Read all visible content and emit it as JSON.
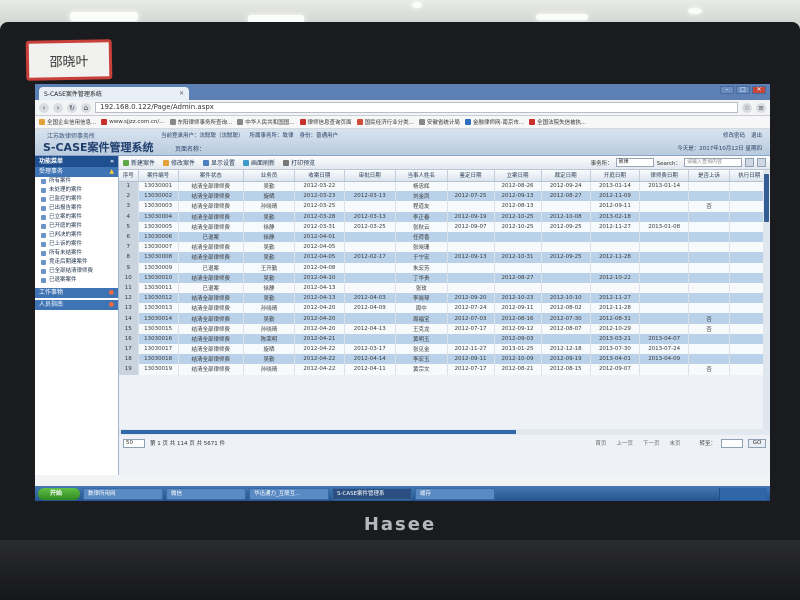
{
  "sticky_note": "邵晓叶",
  "laptop_brand": "Hasee",
  "browser": {
    "tab_title": "S-CASE案件管理系统",
    "url": "192.168.0.122/Page/Admin.aspx",
    "bookmarks": [
      "全国企业信用信息...",
      "www.sjjzz.com.cn/...",
      "东阳律师事务所查询...",
      "中华人民共和国国...",
      "律师信息查询页面",
      "国民经济行业分类...",
      "安徽省统计局",
      "金融律师网-南京市...",
      "全国法院失信被执..."
    ]
  },
  "app": {
    "company": "江苏致律师事务所",
    "title": "S-CASE案件管理系统",
    "user_info": [
      "当前登录用户：沈聪聪（沈聪聪）",
      "所属事务所：致律",
      "身份：普通用户"
    ],
    "page_name_label": "页面名称：",
    "top_links": [
      "修改密码",
      "退出"
    ],
    "date": "今天是：2017年10月12日 星期四"
  },
  "sidebar": {
    "header": "功能菜单",
    "section1": "受理事务",
    "items": [
      "所有案件",
      "未处理的案件",
      "已监控的案件",
      "已出报告案件",
      "已立案的案件",
      "已开庭的案件",
      "已判决的案件",
      "已上诉的案件",
      "所有未结案件",
      "竞走后期建案件",
      "已全部结清律师费",
      "已退案案件"
    ],
    "section2": "工作事物",
    "section3": "人员指南"
  },
  "toolbar": {
    "buttons": [
      "新建案件",
      "修改案件",
      "显示设置",
      "画面刷新",
      "打印预览"
    ],
    "filter_label": "事务所：",
    "filter_value": "致律",
    "search_label": "Search：",
    "search_placeholder": "请输入查询内容"
  },
  "table": {
    "columns": [
      "序号",
      "案件编号",
      "案件状态",
      "业务员",
      "收案日期",
      "审批日期",
      "当事人姓名",
      "鉴定日期",
      "立案日期",
      "裁定日期",
      "开庭日期",
      "律师费日期",
      "是否上诉",
      "执行日期"
    ],
    "rows": [
      [
        "1",
        "13030001",
        "结清全部律师费",
        "吴勤",
        "2012-03-22",
        "",
        "杨忠辉",
        "",
        "2012-08-26",
        "2012-09-24",
        "2013-01-14",
        "2013-01-14",
        "",
        ""
      ],
      [
        "2",
        "13030002",
        "结清全部律师费",
        "旋晒",
        "2012-03-23",
        "2012-03-13",
        "刘金凤",
        "2012-07-25",
        "2012-09-13",
        "2012-08-27",
        "2012-11-09",
        "",
        "",
        ""
      ],
      [
        "3",
        "13030003",
        "结清全部律师费",
        "孙晓晴",
        "2012-03-25",
        "",
        "程道友",
        "",
        "2012-08-13",
        "",
        "2012-09-11",
        "",
        "否",
        ""
      ],
      [
        "4",
        "13030004",
        "结清全部律师费",
        "吴勤",
        "2012-03-28",
        "2012-03-13",
        "李正春",
        "2012-09-19",
        "2012-10-25",
        "2012-10-08",
        "2013-02-18",
        "",
        "",
        ""
      ],
      [
        "5",
        "13030005",
        "结清全部律师费",
        "徐静",
        "2012-03-31",
        "2012-03-25",
        "张秋云",
        "2012-09-07",
        "2012-10-25",
        "2012-09-25",
        "2012-11-27",
        "2013-01-08",
        "",
        ""
      ],
      [
        "6",
        "13030006",
        "已退案",
        "徐静",
        "2012-04-01",
        "",
        "任荷香",
        "",
        "",
        "",
        "",
        "",
        "",
        ""
      ],
      [
        "7",
        "13030007",
        "结清全部律师费",
        "吴勤",
        "2012-04-05",
        "",
        "张晓珊",
        "",
        "",
        "",
        "",
        "",
        "",
        ""
      ],
      [
        "8",
        "13030008",
        "结清全部律师费",
        "吴勤",
        "2012-04-05",
        "2012-02-17",
        "于宁宏",
        "2012-09-13",
        "2012-10-31",
        "2012-09-25",
        "2012-11-28",
        "",
        "",
        ""
      ],
      [
        "9",
        "13030009",
        "已退案",
        "王开勤",
        "2012-04-08",
        "",
        "朱宏芳",
        "",
        "",
        "",
        "",
        "",
        "",
        ""
      ],
      [
        "10",
        "13030010",
        "结清全部律师费",
        "吴勤",
        "2012-04-10",
        "",
        "丁华贵",
        "",
        "2012-08-27",
        "",
        "2012-10-22",
        "",
        "",
        ""
      ],
      [
        "11",
        "13030011",
        "已退案",
        "徐静",
        "2012-04-13",
        "",
        "张玫",
        "",
        "",
        "",
        "",
        "",
        "",
        ""
      ],
      [
        "12",
        "13030012",
        "结清全部律师费",
        "吴勤",
        "2012-04-13",
        "2012-04-03",
        "李晓琴",
        "2012-09-20",
        "2012-10-23",
        "2012-10-10",
        "2012-11-27",
        "",
        "",
        ""
      ],
      [
        "13",
        "13030013",
        "结清全部律师费",
        "孙晓晴",
        "2012-04-20",
        "2012-04-09",
        "周中",
        "2012-07-24",
        "2012-09-11",
        "2012-08-02",
        "2012-11-28",
        "",
        "",
        ""
      ],
      [
        "14",
        "13030014",
        "结清全部律师费",
        "吴勤",
        "2012-04-20",
        "",
        "周福宝",
        "2012-07-03",
        "2012-08-16",
        "2012-07-30",
        "2012-08-31",
        "",
        "否",
        ""
      ],
      [
        "15",
        "13030015",
        "结清全部律师费",
        "孙晓晴",
        "2012-04-20",
        "2012-04-13",
        "王克龙",
        "2012-07-17",
        "2012-09-12",
        "2012-08-07",
        "2012-10-29",
        "",
        "否",
        ""
      ],
      [
        "16",
        "13030016",
        "结清全部律师费",
        "陈荣明",
        "2012-04-21",
        "",
        "黄明玉",
        "",
        "2012-09-03",
        "",
        "2013-03-21",
        "2013-04-07",
        "",
        ""
      ],
      [
        "17",
        "13030017",
        "结清全部律师费",
        "旋晒",
        "2012-04-22",
        "2012-03-17",
        "张见金",
        "2012-11-27",
        "2013-01-25",
        "2012-12-18",
        "2013-07-30",
        "2013-07-24",
        "",
        ""
      ],
      [
        "18",
        "13030018",
        "结清全部律师费",
        "吴勤",
        "2012-04-22",
        "2012-04-14",
        "李宏玉",
        "2012-09-11",
        "2012-10-09",
        "2012-09-19",
        "2013-04-01",
        "2013-04-09",
        "",
        ""
      ],
      [
        "19",
        "13030019",
        "结清全部律师费",
        "孙晓晴",
        "2012-04-22",
        "2012-04-11",
        "黄宗文",
        "2012-07-17",
        "2012-08-21",
        "2012-08-15",
        "2012-09-07",
        "",
        "否",
        ""
      ]
    ]
  },
  "pager": {
    "page_size": "50",
    "summary": "第 1 页 共 114 页 共 5671 件",
    "links": [
      "首页",
      "上一页",
      "下一页",
      "末页"
    ],
    "goto_label": "转至：",
    "go": "GO"
  },
  "taskbar": {
    "start": "开始",
    "tasks": [
      "数律所用网",
      "微信",
      "华迅通力_互联互...",
      "S-CASE案件管理系",
      "缓存"
    ]
  }
}
